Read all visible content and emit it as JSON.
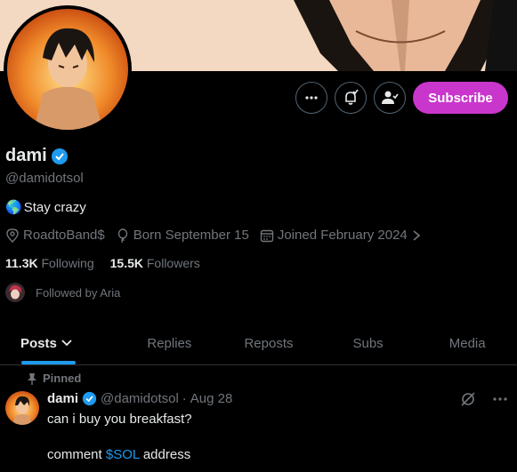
{
  "profile": {
    "display_name": "dami",
    "handle": "@damidotsol",
    "bio_emoji": "🌎",
    "bio": "Stay crazy",
    "location": "RoadtoBand$",
    "birthday": "Born September 15",
    "joined": "Joined February 2024",
    "following_count": "11.3K",
    "following_label": "Following",
    "followers_count": "15.5K",
    "followers_label": "Followers",
    "followed_by": "Followed by Aria"
  },
  "actions": {
    "subscribe_label": "Subscribe"
  },
  "tabs": [
    "Posts",
    "Replies",
    "Reposts",
    "Subs",
    "Media"
  ],
  "post": {
    "pinned_label": "Pinned",
    "name": "dami",
    "handle": "@damidotsol",
    "separator": "·",
    "date": "Aug 28",
    "line1": "can i buy you breakfast?",
    "line2_prefix": "comment",
    "cashtag": "$SOL",
    "line2_suffix": "address"
  },
  "colors": {
    "accent": "#1d9bf0",
    "subscribe": "#c936cc",
    "muted": "#71767b"
  }
}
